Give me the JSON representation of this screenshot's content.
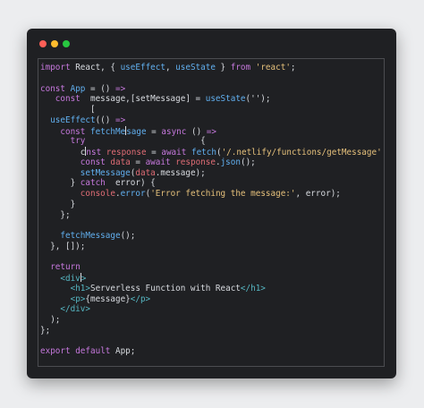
{
  "window": {
    "controls": [
      {
        "name": "close",
        "color": "#ff5f57"
      },
      {
        "name": "minimize",
        "color": "#febc2e"
      },
      {
        "name": "maximize",
        "color": "#28c840"
      }
    ]
  },
  "colors": {
    "background": "#ecedef",
    "window": "#1f2023",
    "keyword": "#c678dd",
    "function": "#61afef",
    "string": "#e5c07b",
    "identifier": "#e06c75",
    "jsx_tag": "#56b6c2",
    "text": "#d8dbe0"
  },
  "code_lines": [
    [
      {
        "t": "kw",
        "v": "import"
      },
      {
        "t": "plain",
        "v": " React, { "
      },
      {
        "t": "fn",
        "v": "useEffect"
      },
      {
        "t": "plain",
        "v": ", "
      },
      {
        "t": "fn",
        "v": "useState"
      },
      {
        "t": "plain",
        "v": " } "
      },
      {
        "t": "kw",
        "v": "from"
      },
      {
        "t": "plain",
        "v": " "
      },
      {
        "t": "str",
        "v": "'react'"
      },
      {
        "t": "plain",
        "v": ";"
      }
    ],
    [],
    [
      {
        "t": "kw",
        "v": "const"
      },
      {
        "t": "plain",
        "v": " "
      },
      {
        "t": "fn",
        "v": "App"
      },
      {
        "t": "plain",
        "v": " = () "
      },
      {
        "t": "kw",
        "v": "=>"
      }
    ],
    [
      {
        "t": "plain",
        "v": "   "
      },
      {
        "t": "kw",
        "v": "const"
      },
      {
        "t": "plain",
        "v": "  message,[setMessage] = "
      },
      {
        "t": "fn",
        "v": "useState"
      },
      {
        "t": "plain",
        "v": "('');"
      }
    ],
    [
      {
        "t": "plain",
        "v": "          ["
      }
    ],
    [
      {
        "t": "plain",
        "v": "  "
      },
      {
        "t": "fn",
        "v": "useEffect"
      },
      {
        "t": "plain",
        "v": "(() "
      },
      {
        "t": "kw",
        "v": "=>"
      }
    ],
    [
      {
        "t": "plain",
        "v": "    "
      },
      {
        "t": "kw",
        "v": "const"
      },
      {
        "t": "plain",
        "v": " "
      },
      {
        "t": "fn",
        "v": "fetchMe"
      },
      {
        "t": "cursor",
        "v": ""
      },
      {
        "t": "fn",
        "v": "sage"
      },
      {
        "t": "plain",
        "v": " = "
      },
      {
        "t": "kw",
        "v": "async"
      },
      {
        "t": "plain",
        "v": " () "
      },
      {
        "t": "kw",
        "v": "=>"
      }
    ],
    [
      {
        "t": "plain",
        "v": "      "
      },
      {
        "t": "kw",
        "v": "try"
      },
      {
        "t": "plain",
        "v": "                       {"
      }
    ],
    [
      {
        "t": "plain",
        "v": "        c"
      },
      {
        "t": "cursor",
        "v": ""
      },
      {
        "t": "kw",
        "v": "nst"
      },
      {
        "t": "plain",
        "v": " "
      },
      {
        "t": "var",
        "v": "response"
      },
      {
        "t": "plain",
        "v": " = "
      },
      {
        "t": "kw",
        "v": "await"
      },
      {
        "t": "plain",
        "v": " "
      },
      {
        "t": "fn",
        "v": "fetch"
      },
      {
        "t": "plain",
        "v": "("
      },
      {
        "t": "str",
        "v": "'/.netlify/functions/getMessage'"
      },
      {
        "t": "plain",
        "v": ");"
      }
    ],
    [
      {
        "t": "plain",
        "v": "        "
      },
      {
        "t": "kw",
        "v": "const"
      },
      {
        "t": "plain",
        "v": " "
      },
      {
        "t": "var",
        "v": "data"
      },
      {
        "t": "plain",
        "v": " = "
      },
      {
        "t": "kw",
        "v": "await"
      },
      {
        "t": "plain",
        "v": " "
      },
      {
        "t": "var",
        "v": "response"
      },
      {
        "t": "plain",
        "v": "."
      },
      {
        "t": "fn",
        "v": "json"
      },
      {
        "t": "plain",
        "v": "();"
      }
    ],
    [
      {
        "t": "plain",
        "v": "        "
      },
      {
        "t": "fn",
        "v": "setMessage"
      },
      {
        "t": "plain",
        "v": "("
      },
      {
        "t": "var",
        "v": "data"
      },
      {
        "t": "plain",
        "v": ".message);"
      }
    ],
    [
      {
        "t": "plain",
        "v": "      } "
      },
      {
        "t": "kw",
        "v": "catch"
      },
      {
        "t": "plain",
        "v": "  error) {"
      }
    ],
    [
      {
        "t": "plain",
        "v": "        "
      },
      {
        "t": "var",
        "v": "console"
      },
      {
        "t": "plain",
        "v": "."
      },
      {
        "t": "fn",
        "v": "error"
      },
      {
        "t": "plain",
        "v": "("
      },
      {
        "t": "str",
        "v": "'Error fetching the message:'"
      },
      {
        "t": "plain",
        "v": ", error);"
      }
    ],
    [
      {
        "t": "plain",
        "v": "      }"
      }
    ],
    [
      {
        "t": "plain",
        "v": "    };"
      }
    ],
    [],
    [
      {
        "t": "plain",
        "v": "    "
      },
      {
        "t": "fn",
        "v": "fetchMessage"
      },
      {
        "t": "plain",
        "v": "();"
      }
    ],
    [
      {
        "t": "plain",
        "v": "  }, []);"
      }
    ],
    [],
    [
      {
        "t": "plain",
        "v": "  "
      },
      {
        "t": "kw",
        "v": "return"
      }
    ],
    [
      {
        "t": "plain",
        "v": "    "
      },
      {
        "t": "tag",
        "v": "<div"
      },
      {
        "t": "cursor",
        "v": ""
      },
      {
        "t": "tag",
        "v": ">"
      }
    ],
    [
      {
        "t": "plain",
        "v": "      "
      },
      {
        "t": "tag",
        "v": "<h1>"
      },
      {
        "t": "plain",
        "v": "Serverless Function with React"
      },
      {
        "t": "tag",
        "v": "</h1>"
      }
    ],
    [
      {
        "t": "plain",
        "v": "      "
      },
      {
        "t": "tag",
        "v": "<p>"
      },
      {
        "t": "plain",
        "v": "{message}"
      },
      {
        "t": "tag",
        "v": "</p>"
      }
    ],
    [
      {
        "t": "plain",
        "v": "    "
      },
      {
        "t": "tag",
        "v": "</div>"
      }
    ],
    [
      {
        "t": "plain",
        "v": "  );"
      }
    ],
    [
      {
        "t": "plain",
        "v": "};"
      }
    ],
    [],
    [
      {
        "t": "kw",
        "v": "export"
      },
      {
        "t": "plain",
        "v": " "
      },
      {
        "t": "kw",
        "v": "default"
      },
      {
        "t": "plain",
        "v": " App;"
      }
    ]
  ]
}
